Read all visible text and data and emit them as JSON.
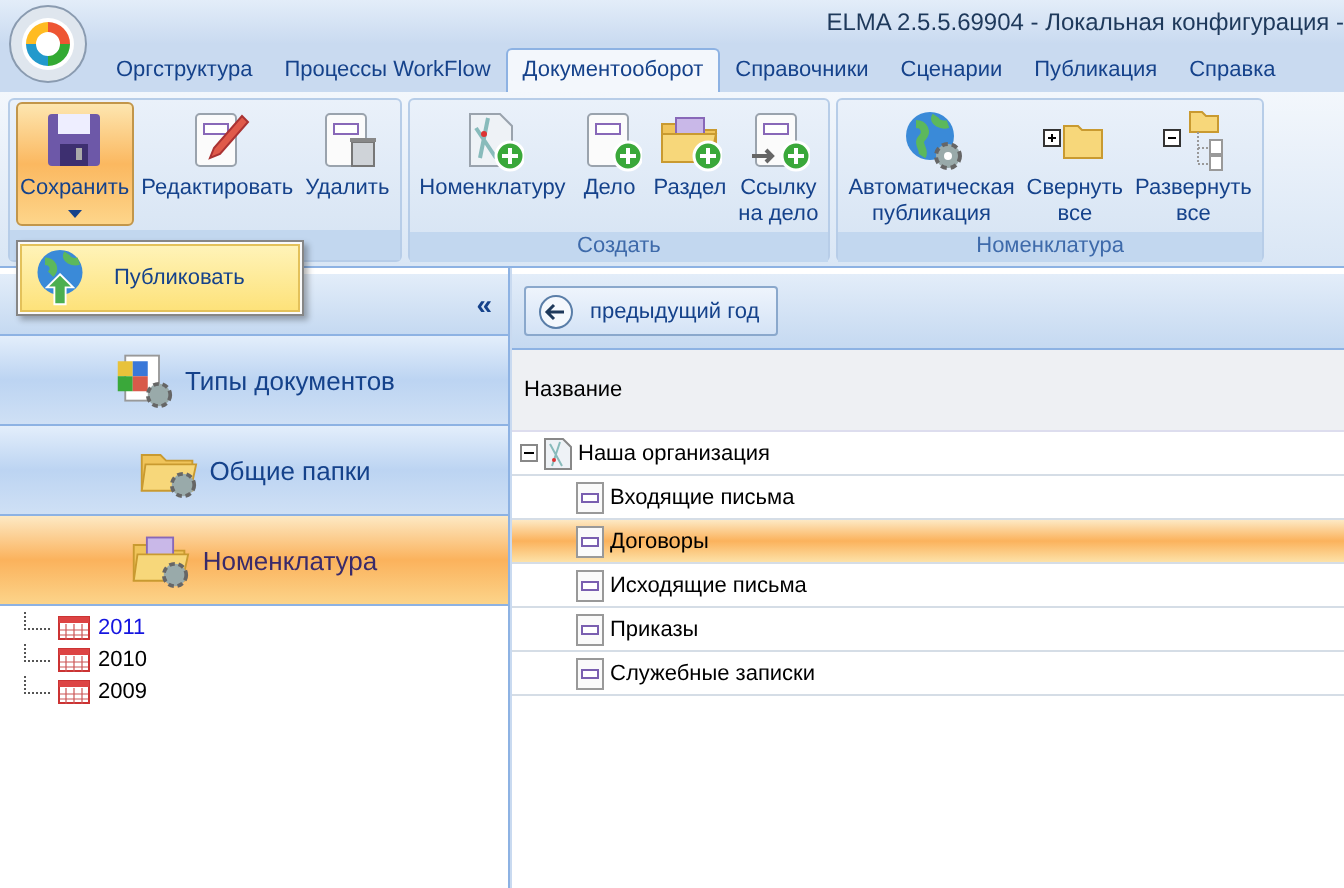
{
  "window": {
    "title": "ELMA 2.5.5.69904 - Локальная конфигурация -"
  },
  "tabs": [
    {
      "label": "Оргструктура",
      "selected": false
    },
    {
      "label": "Процессы WorkFlow",
      "selected": false
    },
    {
      "label": "Документооборот",
      "selected": true
    },
    {
      "label": "Справочники",
      "selected": false
    },
    {
      "label": "Сценарии",
      "selected": false
    },
    {
      "label": "Публикация",
      "selected": false
    },
    {
      "label": "Справка",
      "selected": false
    }
  ],
  "ribbon": {
    "groups": [
      {
        "buttons": [
          {
            "label": "Сохранить",
            "kind": "floppy",
            "pressed": true,
            "dropdown": true
          },
          {
            "label": "Редактировать",
            "kind": "edit",
            "pressed": false,
            "dropdown": false
          },
          {
            "label": "Удалить",
            "kind": "delete",
            "pressed": false,
            "dropdown": false
          }
        ]
      },
      {
        "label": "Создать",
        "buttons": [
          {
            "label": "Номенклатуру",
            "kind": "map-add",
            "pressed": false,
            "dropdown": false
          },
          {
            "label": "Дело",
            "kind": "doc-add",
            "pressed": false,
            "dropdown": false
          },
          {
            "label": "Раздел",
            "kind": "folder-add",
            "pressed": false,
            "dropdown": false
          },
          {
            "label": "Ссылку\nна дело",
            "kind": "link-add",
            "pressed": false,
            "dropdown": false
          }
        ]
      },
      {
        "label": "Номенклатура",
        "buttons": [
          {
            "label": "Автоматическая\nпубликация",
            "kind": "globe",
            "pressed": false,
            "dropdown": false
          },
          {
            "label": "Свернуть\nвсе",
            "kind": "collapse",
            "pressed": false,
            "dropdown": false
          },
          {
            "label": "Развернуть\nвсе",
            "kind": "expand",
            "pressed": false,
            "dropdown": false
          }
        ]
      }
    ]
  },
  "dropdown_menu": {
    "items": [
      {
        "label": "Публиковать",
        "selected": true
      }
    ]
  },
  "navigation": {
    "collapse": "«",
    "items": [
      {
        "label": "Типы документов",
        "kind": "doc-types",
        "selected": false
      },
      {
        "label": "Общие папки",
        "kind": "folder",
        "selected": false
      },
      {
        "label": "Номенклатура",
        "kind": "nomenclature",
        "selected": true
      }
    ]
  },
  "year_tree": {
    "items": [
      {
        "label": "2011",
        "selected": true
      },
      {
        "label": "2010",
        "selected": false
      },
      {
        "label": "2009",
        "selected": false
      }
    ]
  },
  "content": {
    "back_button": "предыдущий год",
    "table": {
      "columns": [
        "Название"
      ],
      "rows": [
        {
          "label": "Наша организация",
          "kind": "organization",
          "expanded": true,
          "selected": false,
          "children": [
            {
              "label": "Входящие письма",
              "kind": "case",
              "selected": false
            },
            {
              "label": "Договоры",
              "kind": "case",
              "selected": true
            },
            {
              "label": "Исходящие письма",
              "kind": "case",
              "selected": false
            },
            {
              "label": "Приказы",
              "kind": "case",
              "selected": false
            },
            {
              "label": "Служебные записки",
              "kind": "case",
              "selected": false
            }
          ]
        }
      ]
    }
  }
}
